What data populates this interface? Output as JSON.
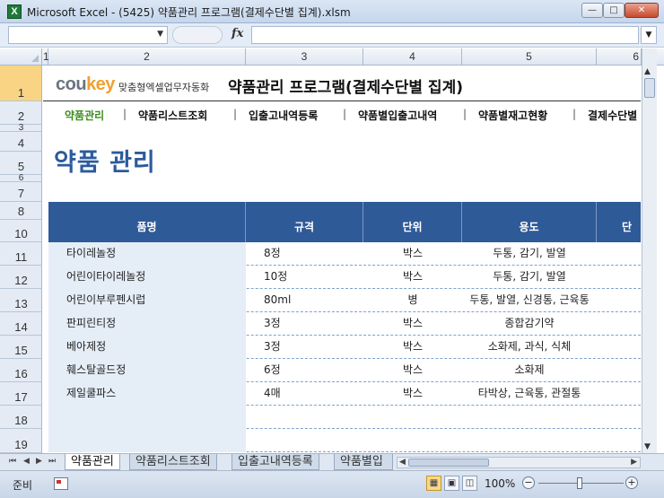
{
  "window": {
    "title": "Microsoft Excel - (5425) 약품관리 프로그램(결제수단별 집계).xlsm",
    "app_icon": "X",
    "minimize": "—",
    "maximize": "□",
    "close": "✕"
  },
  "formula_bar": {
    "name_box": "",
    "fx": "fx",
    "formula": ""
  },
  "columns": [
    "1",
    "2",
    "3",
    "4",
    "5",
    "6"
  ],
  "rows": [
    "1",
    "2",
    "3",
    "4",
    "5",
    "6",
    "7",
    "8",
    "10",
    "11",
    "12",
    "13",
    "14",
    "15",
    "16",
    "17",
    "18",
    "19"
  ],
  "header": {
    "brand_prefix": "cou",
    "brand_accent": "key",
    "tagline": "맞춤형엑셀업무자동화",
    "title": "약품관리 프로그램(결제수단별 집계)"
  },
  "nav": {
    "items": [
      "약품관리",
      "약품리스트조회",
      "입출고내역등록",
      "약품별입출고내역",
      "약품별재고현황",
      "결제수단별"
    ],
    "separator": "|"
  },
  "page_heading": "약품 관리",
  "table": {
    "headers": [
      "품명",
      "규격",
      "단위",
      "용도",
      "단"
    ],
    "rows": [
      [
        "타이레놀정",
        "8정",
        "박스",
        "두통, 감기, 발열"
      ],
      [
        "어린이타이레놀정",
        "10정",
        "박스",
        "두통, 감기, 발열"
      ],
      [
        "어린이부루펜시럽",
        "80ml",
        "병",
        "두통, 발열, 신경통, 근육통"
      ],
      [
        "판피린티정",
        "3정",
        "박스",
        "종합감기약"
      ],
      [
        "베아제정",
        "3정",
        "박스",
        "소화제, 과식, 식체"
      ],
      [
        "훼스탈골드정",
        "6정",
        "박스",
        "소화제"
      ],
      [
        "제일쿨파스",
        "4매",
        "박스",
        "타박상, 근육통, 관절통"
      ]
    ]
  },
  "sheet_tabs": [
    "약품관리",
    "약품리스트조회",
    "입출고내역등록",
    "약품별입"
  ],
  "status": {
    "ready": "준비",
    "zoom": "100%",
    "zoom_minus": "−",
    "zoom_plus": "+"
  },
  "colors": {
    "table_header_bg": "#2f5a98",
    "heading_blue": "#2c5b9b",
    "nav_active": "#3d8f1f",
    "brand_orange": "#f0a030"
  }
}
